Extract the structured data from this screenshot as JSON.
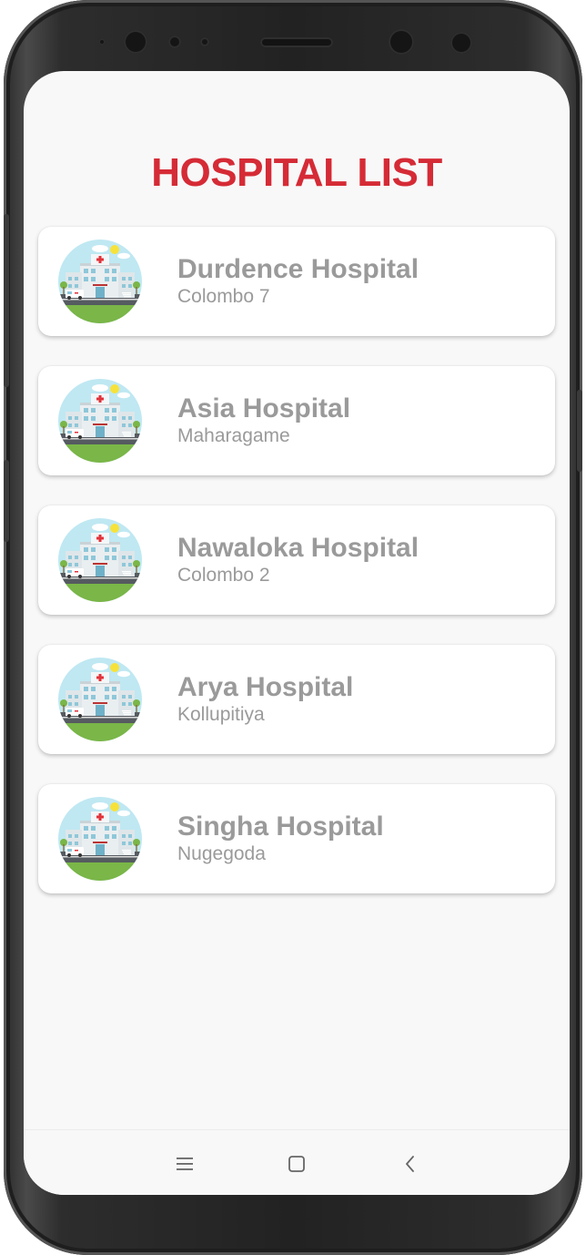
{
  "title": "HOSPITAL LIST",
  "colors": {
    "title": "#d52b36",
    "card_text": "#9a9a9a",
    "screen_bg": "#f8f8f8"
  },
  "hospitals": [
    {
      "name": "Durdence Hospital",
      "location": "Colombo 7",
      "icon": "hospital-building-icon"
    },
    {
      "name": "Asia Hospital",
      "location": "Maharagame",
      "icon": "hospital-building-icon"
    },
    {
      "name": "Nawaloka Hospital",
      "location": "Colombo 2",
      "icon": "hospital-building-icon"
    },
    {
      "name": "Arya Hospital",
      "location": "Kollupitiya",
      "icon": "hospital-building-icon"
    },
    {
      "name": "Singha Hospital",
      "location": "Nugegoda",
      "icon": "hospital-building-icon"
    }
  ],
  "nav_bar": {
    "recent_icon": "recent-apps-icon",
    "home_icon": "home-icon",
    "back_icon": "back-icon"
  }
}
